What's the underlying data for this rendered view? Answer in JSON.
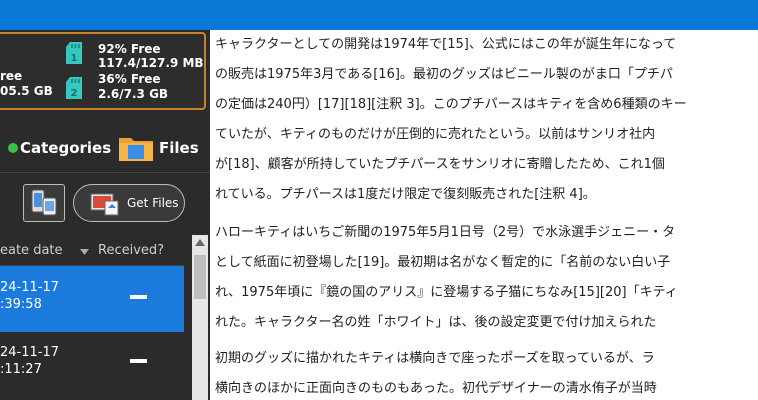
{
  "storage": {
    "left_partial": {
      "line1": "ree",
      "line2": "05.5 GB"
    },
    "sd1": {
      "index": "1",
      "percent": "92% Free",
      "size": "117.4/127.9 MB"
    },
    "sd2": {
      "index": "2",
      "percent": "36% Free",
      "size": "2.6/7.3 GB"
    }
  },
  "nav": {
    "categories": "Categories",
    "files": "Files"
  },
  "toolbar": {
    "get_files": "Get Files"
  },
  "table": {
    "headers": {
      "create_date": "eate date",
      "received": "Received?"
    },
    "rows": [
      {
        "date": "24-11-17",
        "time": ":39:58",
        "received": "—",
        "selected": true
      },
      {
        "date": "24-11-17",
        "time": ":11:27",
        "received": "—",
        "selected": false
      }
    ]
  },
  "article": {
    "paragraphs": [
      [
        "キャラクターとしての開発は1974年で[15]、公式にはこの年が誕生年になって",
        "の販売は1975年3月である[16]。最初のグッズはビニール製のがま口「プチパ",
        "の定価は240円）[17][18][注釈 3]。このプチパースはキティを含め6種類のキー",
        "ていたが、キティのものだけが圧倒的に売れたという。以前はサンリオ社内",
        "が[18]、顧客が所持していたプチパースをサンリオに寄贈したため、これ1個",
        "れている。プチパースは1度だけ限定で復刻販売された[注釈 4]。"
      ],
      [
        "ハローキティはいちご新聞の1975年5月1日号（2号）で水泳選手ジェニー・タ",
        "として紙面に初登場した[19]。最初期は名がなく暫定的に「名前のない白い子",
        "れ、1975年頃に『鏡の国のアリス』に登場する子猫にちなみ[15][20]「キティ",
        "れた。キャラクター名の姓「ホワイト」は、後の設定変更で付け加えられた"
      ],
      [
        "初期のグッズに描かれたキティは横向きで座ったポーズを取っているが、ラ",
        "横向きのほかに正面向きのものもあった。初代デザイナーの清水侑子が当時"
      ]
    ]
  },
  "colors": {
    "accent_blue": "#0a78d7",
    "sd_teal": "#35c8c0",
    "storage_border": "#c8832a",
    "selected_row": "#1b7bdc",
    "panel_bg": "#2b2b2b"
  },
  "icons": [
    "sd-card-icon",
    "categories-icon",
    "folder-icon",
    "phone-transfer-icon",
    "get-files-icon",
    "sort-arrow-icon",
    "scroll-up-icon"
  ]
}
